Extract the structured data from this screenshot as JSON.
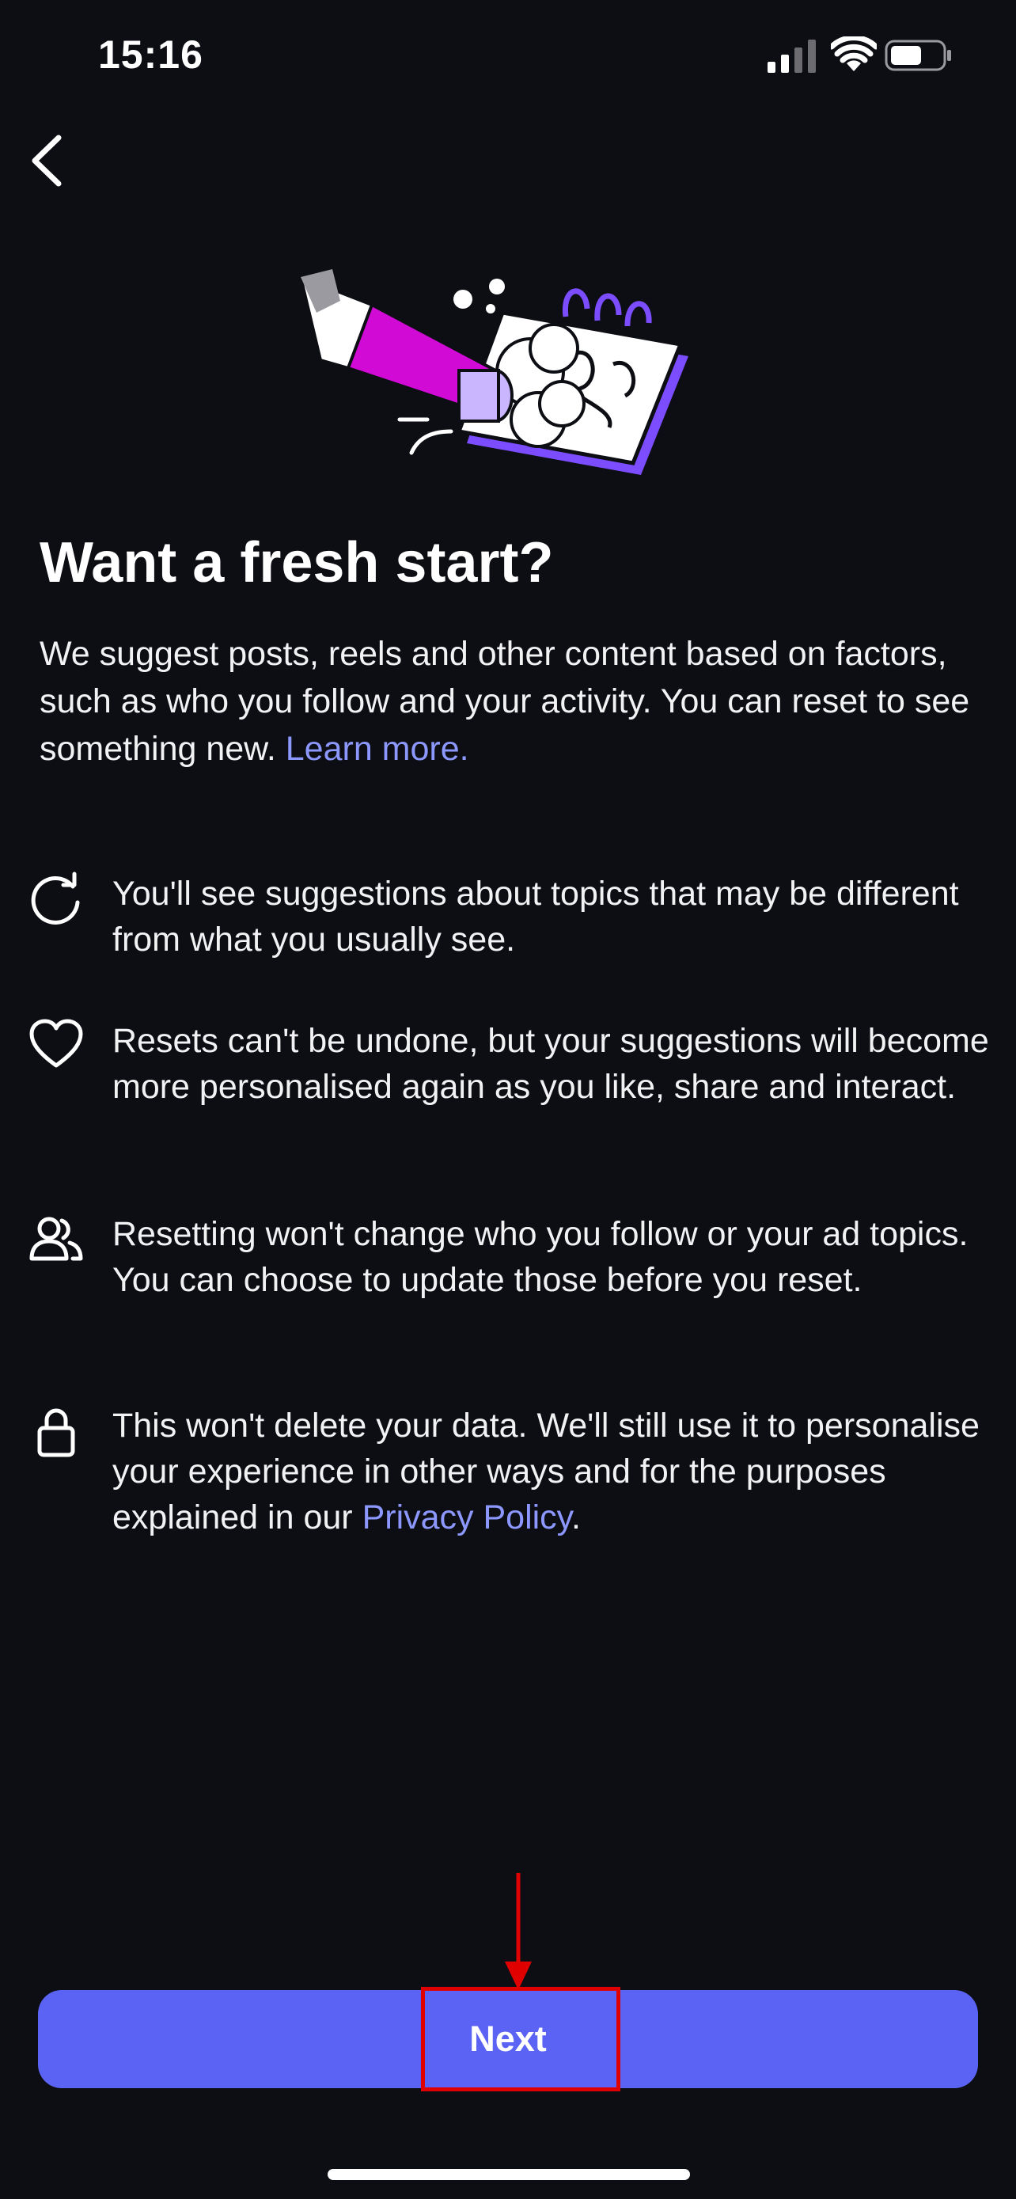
{
  "status_bar": {
    "time": "15:16"
  },
  "header": {
    "back_icon": "chevron-left-icon"
  },
  "illustration": {
    "icon": "pencil-notebook-illustration",
    "colors": {
      "magenta": "#d10ad6",
      "purple": "#7b4dff",
      "lavender": "#c9b6ff"
    }
  },
  "title": "Want a fresh start?",
  "intro": {
    "text": "We suggest posts, reels and other content based on factors, such as who you follow and your activity. You can reset to see something new.",
    "link": "Learn more."
  },
  "items": [
    {
      "icon": "refresh-icon",
      "text": "You'll see suggestions about topics that may be different from what you usually see."
    },
    {
      "icon": "heart-icon",
      "text": "Resets can't be undone, but your suggestions will become more personalised again as you like, share and interact."
    },
    {
      "icon": "people-icon",
      "text": "Resetting won't change who you follow or your ad topics. You can choose to update those before you reset."
    },
    {
      "icon": "lock-icon",
      "text": "This won't delete your data. We'll still use it to personalise your experience in other ways and for the purposes explained in our",
      "link": "Privacy Policy",
      "suffix": "."
    }
  ],
  "next_button": {
    "label": "Next"
  },
  "colors": {
    "background": "#0c0e14",
    "accent": "#5b63f5",
    "link": "#8d98ff",
    "annotation": "#e00000"
  }
}
